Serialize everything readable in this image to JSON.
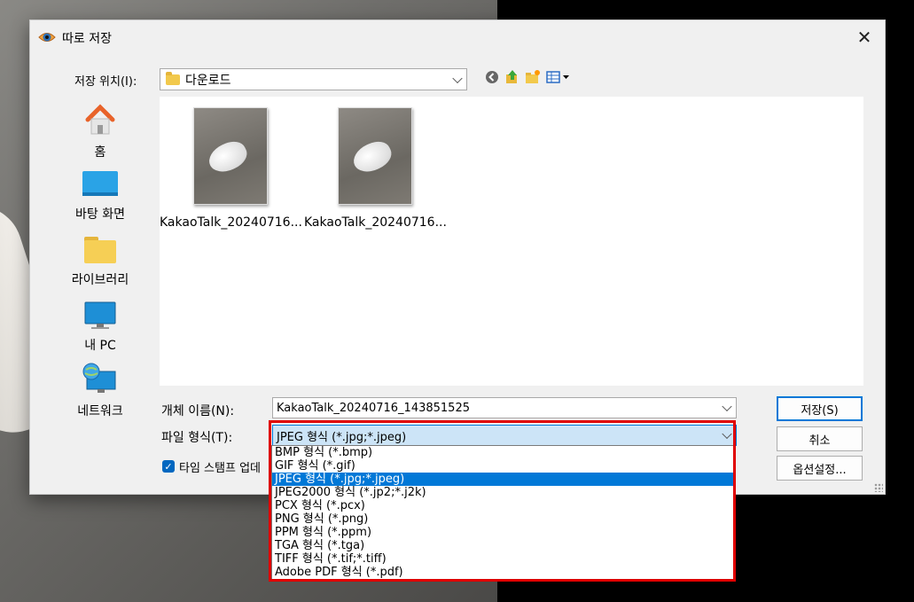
{
  "window": {
    "title": "따로 저장"
  },
  "location": {
    "label": "저장 위치(I):",
    "value": "다운로드"
  },
  "toolbar": {
    "icons": [
      "back-icon",
      "up-folder-icon",
      "new-folder-icon",
      "view-menu-icon"
    ]
  },
  "sidebar": {
    "items": [
      {
        "label": "홈",
        "icon": "home-icon"
      },
      {
        "label": "바탕 화면",
        "icon": "desktop-icon"
      },
      {
        "label": "라이브러리",
        "icon": "library-folder-icon"
      },
      {
        "label": "내 PC",
        "icon": "this-pc-icon"
      },
      {
        "label": "네트워크",
        "icon": "network-icon"
      }
    ]
  },
  "files": [
    {
      "name": "KakaoTalk_20240716..."
    },
    {
      "name": "KakaoTalk_20240716..."
    }
  ],
  "filename": {
    "label": "개체 이름(N):",
    "value": "KakaoTalk_20240716_143851525"
  },
  "filetype": {
    "label": "파일 형식(T):",
    "value": "JPEG 형식 (*.jpg;*.jpeg)",
    "options": [
      "BMP 형식 (*.bmp)",
      "GIF 형식 (*.gif)",
      "JPEG 형식 (*.jpg;*.jpeg)",
      "JPEG2000 형식 (*.jp2;*.j2k)",
      "PCX 형식 (*.pcx)",
      "PNG 형식 (*.png)",
      "PPM 형식 (*.ppm)",
      "TGA 형식 (*.tga)",
      "TIFF 형식 (*.tif;*.tiff)",
      "Adobe PDF 형식 (*.pdf)"
    ],
    "selected_index": 2
  },
  "timestamp_checkbox": {
    "label": "타임 스탬프 업데",
    "checked": true
  },
  "buttons": {
    "save": "저장(S)",
    "cancel": "취소",
    "options": "옵션설정..."
  },
  "colors": {
    "accent": "#0078d7",
    "highlight_border": "#e00000"
  }
}
